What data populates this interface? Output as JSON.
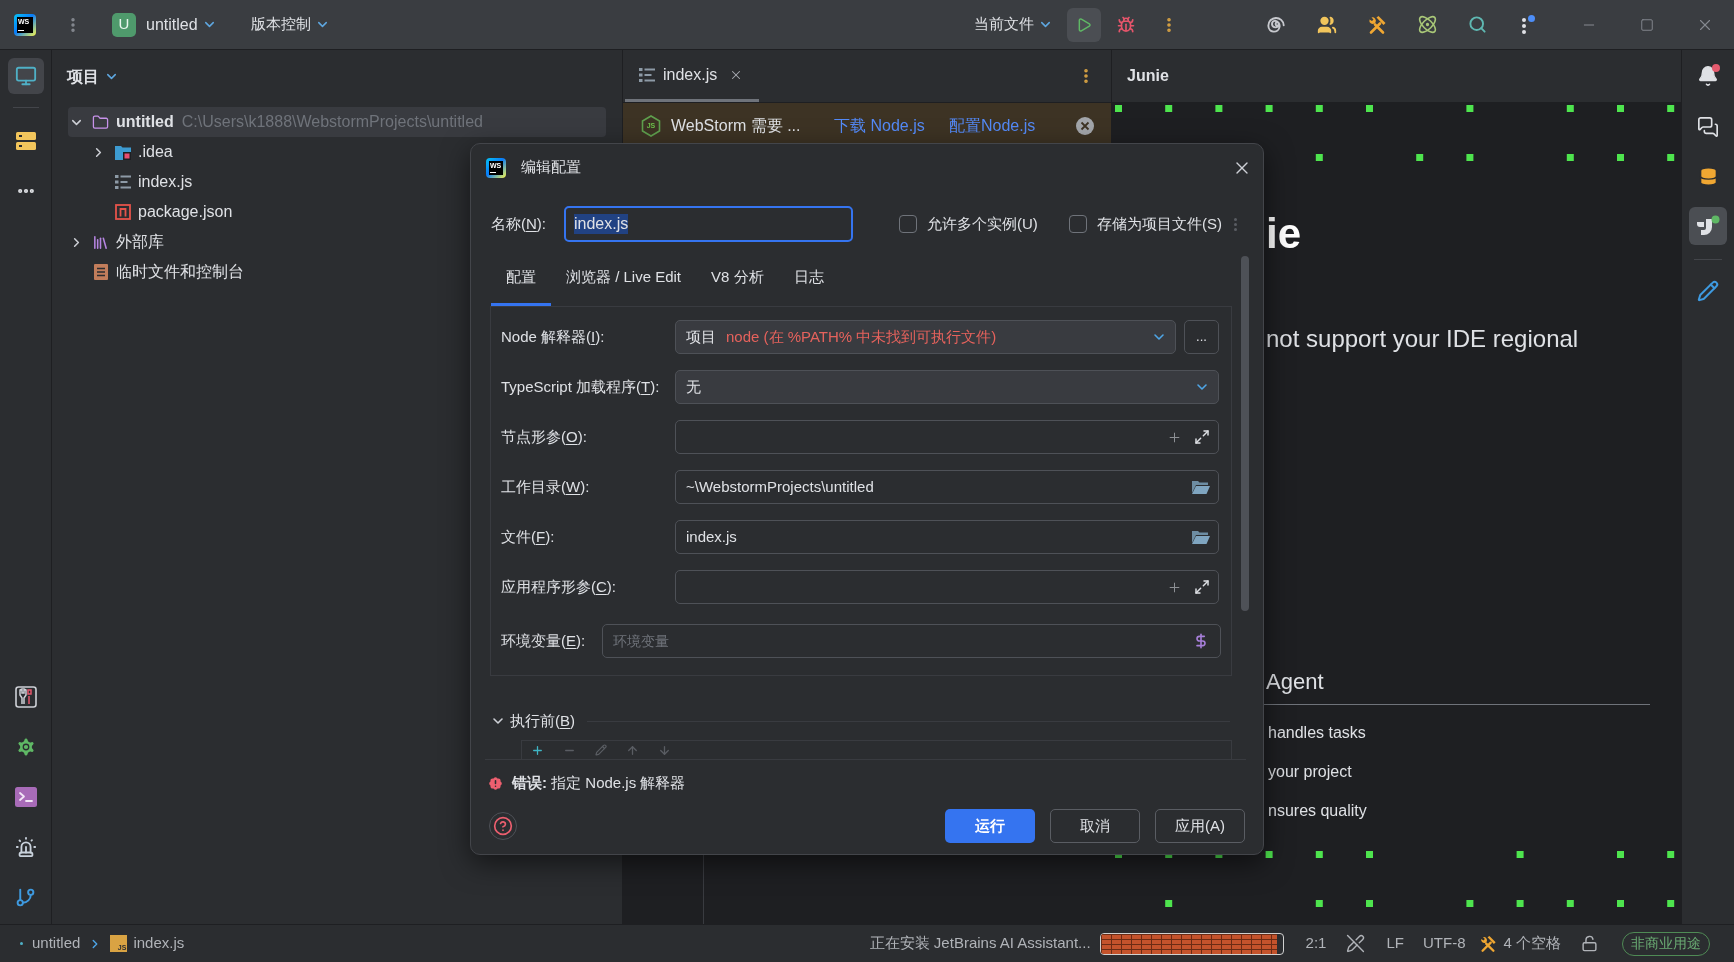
{
  "title_bar": {
    "logo": "WS",
    "project": {
      "initial": "U",
      "name": "untitled"
    },
    "vcs": "版本控制",
    "run_config": "当前文件"
  },
  "project_panel": {
    "title": "项目",
    "tree": [
      {
        "label": "untitled",
        "path": "C:\\Users\\k1888\\WebstormProjects\\untitled",
        "kind": "folder",
        "expanded": true,
        "selected": true,
        "children": [
          {
            "label": ".idea",
            "kind": "idea-folder",
            "expanded": false,
            "selected": false
          },
          {
            "label": "index.js",
            "kind": "js-file",
            "selected": false
          },
          {
            "label": "package.json",
            "kind": "json-file",
            "selected": false
          }
        ]
      },
      {
        "label": "外部库",
        "kind": "library",
        "expanded": false,
        "selected": false
      },
      {
        "label": "临时文件和控制台",
        "kind": "scratches",
        "selected": false
      }
    ]
  },
  "editor": {
    "tabs": [
      {
        "label": "index.js",
        "kind": "js-file",
        "selected": true
      }
    ],
    "banner": {
      "icon_text": "JS",
      "message": "WebStorm 需要 ...",
      "links": [
        "下载 Node.js",
        "配置Node.js"
      ]
    }
  },
  "junie_panel": {
    "title": "Junie",
    "heading": "ie",
    "subtitle": "not support your IDE regional",
    "section_title": "Agent",
    "features": [
      "handles tasks",
      "your project",
      "nsures quality"
    ]
  },
  "dialog": {
    "logo": "WS",
    "title": "编辑配置",
    "name": {
      "label": "名称(N):",
      "value": "index.js"
    },
    "checkboxes": [
      {
        "label": "允许多个实例(U)",
        "checked": false
      },
      {
        "label": "存储为项目文件(S)",
        "checked": false
      }
    ],
    "tabs": [
      {
        "label": "配置",
        "selected": true
      },
      {
        "label": "浏览器 / Live Edit",
        "selected": false
      },
      {
        "label": "V8 分析",
        "selected": false
      },
      {
        "label": "日志",
        "selected": false
      }
    ],
    "fields": [
      {
        "kind": "combo",
        "label": "Node 解释器(I):",
        "prefix": "项目",
        "value": "node (在 %PATH% 中未找到可执行文件)",
        "error": true,
        "button": "..."
      },
      {
        "kind": "combo",
        "label": "TypeScript 加载程序(T):",
        "value": "无",
        "error": false
      },
      {
        "kind": "args",
        "label": "节点形参(O):"
      },
      {
        "kind": "path",
        "label": "工作目录(W):",
        "value": "~\\WebstormProjects\\untitled"
      },
      {
        "kind": "path",
        "label": "文件(F):",
        "value": "index.js"
      },
      {
        "kind": "args",
        "label": "应用程序形参(C):"
      },
      {
        "kind": "env",
        "label": "环境变量(E):",
        "placeholder": "环境变量"
      }
    ],
    "before_launch": {
      "title": "执行前(B)",
      "expanded": true
    },
    "error": "**错误:** 指定 Node.js 解释器",
    "buttons": [
      {
        "label": "运行",
        "kind": "primary"
      },
      {
        "label": "取消",
        "kind": "secondary"
      },
      {
        "label": "应用(A)",
        "kind": "secondary"
      }
    ]
  },
  "status_bar": {
    "breadcrumbs": [
      {
        "label": "untitled",
        "kind": "module"
      },
      {
        "label": "index.js",
        "kind": "js",
        "icon_text": "JS"
      }
    ],
    "task": "正在安装 JetBrains AI Assistant...",
    "progress": {
      "level": 0.97
    },
    "position": "2:1",
    "line_separator": "LF",
    "encoding": "UTF-8",
    "indent": "4 个空格",
    "license": "非商业用途"
  }
}
